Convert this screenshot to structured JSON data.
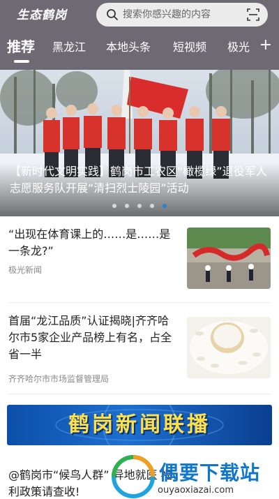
{
  "header": {
    "logo": "生态鹤岗",
    "search_placeholder": "搜索你感兴趣的内容",
    "search_icon": "search-icon",
    "scan_icon": "scan-icon"
  },
  "tabs": [
    {
      "label": "推荐",
      "active": true
    },
    {
      "label": "黑龙江",
      "active": false
    },
    {
      "label": "本地头条",
      "active": false
    },
    {
      "label": "短视频",
      "active": false
    },
    {
      "label": "极光",
      "active": false
    }
  ],
  "tabs_add_label": "+",
  "banner": {
    "caption": "【新时代文明实践】鹤岗市工农区“橄榄绿”退役军人志愿服务队开展“清扫烈士陵园”活动",
    "slides": 5,
    "active_slide": 5
  },
  "news": [
    {
      "title": "“出现在体育课上的……是……是一条龙?”",
      "source": "极光新闻"
    },
    {
      "title": "首届“龙江品质”认证揭晓|齐齐哈尔市5家企业产品榜上有名，占全省一半",
      "source": "齐齐哈尔市市场监督管理局"
    },
    {
      "title": "@鹤岗市“候鸟人群” 异地就医 福利政策请查收!",
      "source": ""
    }
  ],
  "video_banner": {
    "label": "鹤岗新闻联播"
  },
  "watermark": {
    "title": "偶要下载站",
    "url": "ouyaoxiazai.com"
  },
  "colors": {
    "header_bg": "#6e6a73",
    "accent": "#2a7fd0",
    "banner_title": "#ffe04a"
  }
}
